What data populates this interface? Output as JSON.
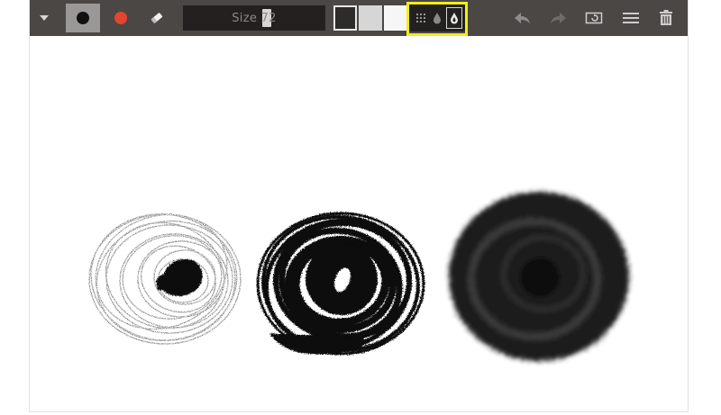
{
  "toolbar": {
    "size_label": "Size",
    "size_value": "72",
    "icons": {
      "menu_toggle": "chevron-down-icon",
      "brush_black": "black-brush-icon",
      "brush_red": "red-brush-icon",
      "eraser": "eraser-icon",
      "texture_dots": "dots-texture-icon",
      "texture_ink": "ink-drop-icon",
      "texture_water": "water-drop-icon",
      "undo": "undo-icon",
      "redo": "redo-icon",
      "fit": "fit-screen-icon",
      "menu": "hamburger-menu-icon",
      "trash": "trash-icon"
    },
    "colors": {
      "bar": "#4a4745",
      "active_brush_bg": "#9a9896",
      "red_brush": "#e4452f",
      "highlight": "#f0ee1a"
    },
    "swatches": [
      "#2d2c2b",
      "#d6d6d6",
      "#f6f6f6"
    ]
  }
}
